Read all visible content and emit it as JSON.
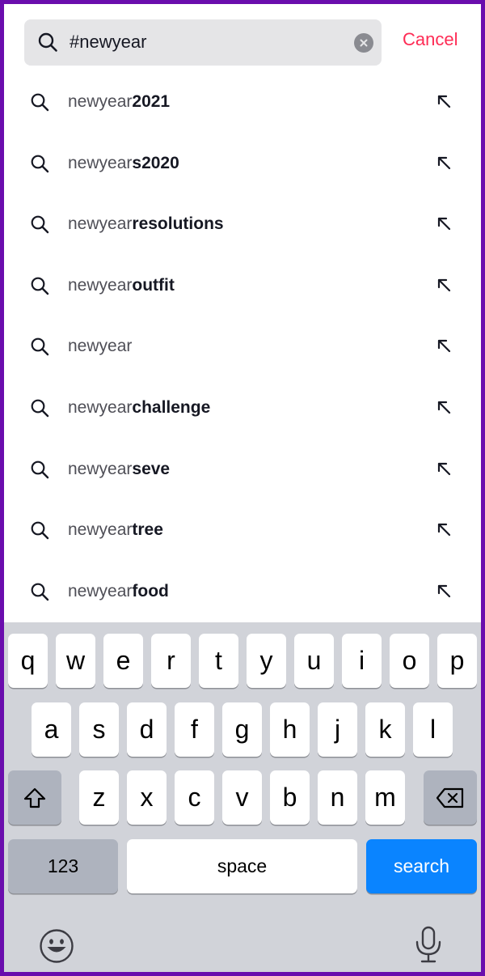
{
  "search": {
    "value": "#newyear",
    "cancel_label": "Cancel"
  },
  "suggestions": [
    {
      "prefix": "newyear",
      "suffix": "2021"
    },
    {
      "prefix": "newyear",
      "suffix": "s2020"
    },
    {
      "prefix": "newyear",
      "suffix": "resolutions"
    },
    {
      "prefix": "newyear",
      "suffix": "outfit"
    },
    {
      "prefix": "newyear",
      "suffix": ""
    },
    {
      "prefix": "newyear",
      "suffix": "challenge"
    },
    {
      "prefix": "newyear",
      "suffix": "seve"
    },
    {
      "prefix": "newyear",
      "suffix": "tree"
    },
    {
      "prefix": "newyear",
      "suffix": "food"
    }
  ],
  "keyboard": {
    "row1": [
      "q",
      "w",
      "e",
      "r",
      "t",
      "y",
      "u",
      "i",
      "o",
      "p"
    ],
    "row2": [
      "a",
      "s",
      "d",
      "f",
      "g",
      "h",
      "j",
      "k",
      "l"
    ],
    "row3": [
      "z",
      "x",
      "c",
      "v",
      "b",
      "n",
      "m"
    ],
    "numbers_label": "123",
    "space_label": "space",
    "search_label": "search"
  },
  "icons": {
    "search": "search-icon",
    "clear": "clear-icon",
    "suggestion_fill": "arrow-up-left-icon",
    "shift": "shift-icon",
    "delete": "backspace-icon",
    "emoji": "emoji-icon",
    "mic": "microphone-icon"
  },
  "colors": {
    "accent": "#fe2c55",
    "search_key": "#0a84ff",
    "field_bg": "#e5e5e7",
    "keyboard_bg": "#d1d3d9"
  }
}
